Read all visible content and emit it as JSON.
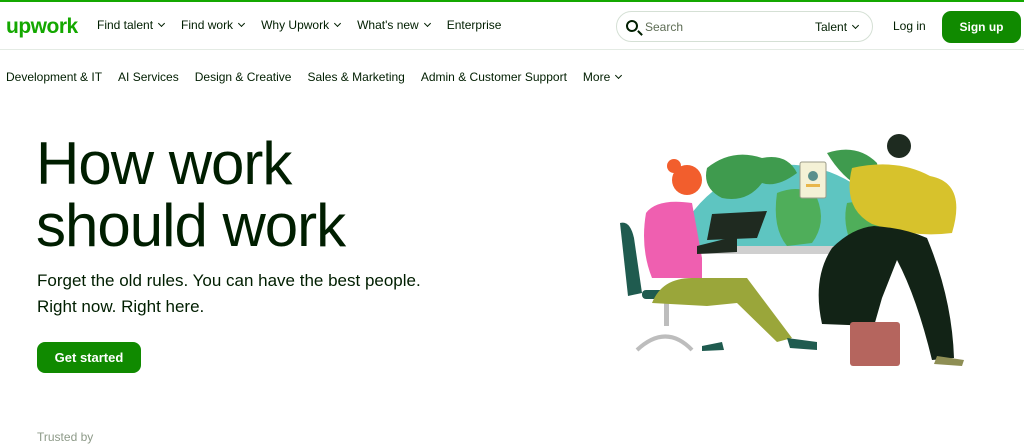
{
  "header": {
    "logo": "upwork",
    "nav": [
      {
        "label": "Find talent",
        "dropdown": true
      },
      {
        "label": "Find work",
        "dropdown": true
      },
      {
        "label": "Why Upwork",
        "dropdown": true
      },
      {
        "label": "What's new",
        "dropdown": true
      },
      {
        "label": "Enterprise",
        "dropdown": false
      }
    ],
    "search": {
      "placeholder": "Search",
      "category": "Talent"
    },
    "login_label": "Log in",
    "signup_label": "Sign up"
  },
  "categories": {
    "items": [
      "Development & IT",
      "AI Services",
      "Design & Creative",
      "Sales & Marketing",
      "Admin & Customer Support"
    ],
    "more_label": "More"
  },
  "hero": {
    "title_line1": "How work",
    "title_line2": "should work",
    "subtitle_line1": "Forget the old rules. You can have the best people.",
    "subtitle_line2": "Right now. Right here.",
    "cta_label": "Get started"
  },
  "trusted_label": "Trusted by",
  "colors": {
    "brand": "#14a800",
    "button": "#108a00",
    "text": "#001e00"
  }
}
